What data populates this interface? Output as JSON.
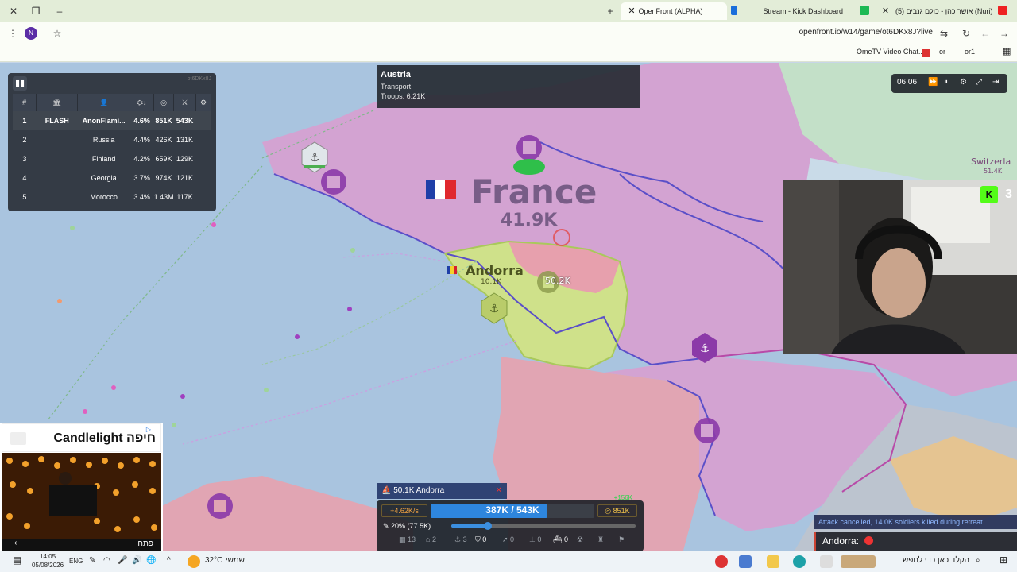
{
  "browser": {
    "tabs": [
      {
        "title": "OpenFront (ALPHA)",
        "active": true
      },
      {
        "title": "Stream - Kick Dashboard",
        "active": false
      },
      {
        "title": "(5) אושר כהן - כולם גנבים (Nuri)",
        "active": false
      }
    ],
    "url": "openfront.io/w14/game/ot6DKx8J?live",
    "profile_initial": "N",
    "bookmarks": [
      "OmeTV Video Chat...",
      "or",
      "or1"
    ]
  },
  "map": {
    "labels": [
      {
        "name": "France",
        "troops": "41.9K"
      },
      {
        "name": "Andorra",
        "troops": "10.1K"
      },
      {
        "name": "Switzerla",
        "troops": "51.4K"
      }
    ],
    "attack_label": "50.2K"
  },
  "leaderboard": {
    "game_id": "ot6DKx8J",
    "headers": {
      "rank": "#"
    },
    "rows": [
      {
        "rank": "1",
        "clan": "FLASH",
        "name": "AnonFlami...",
        "pct": "4.6%",
        "gold": "851K",
        "troops": "543K"
      },
      {
        "rank": "2",
        "clan": "",
        "name": "Russia",
        "pct": "4.4%",
        "gold": "426K",
        "troops": "131K"
      },
      {
        "rank": "3",
        "clan": "",
        "name": "Finland",
        "pct": "4.2%",
        "gold": "659K",
        "troops": "129K"
      },
      {
        "rank": "4",
        "clan": "",
        "name": "Georgia",
        "pct": "3.7%",
        "gold": "974K",
        "troops": "121K"
      },
      {
        "rank": "5",
        "clan": "",
        "name": "Morocco",
        "pct": "3.4%",
        "gold": "1.43M",
        "troops": "117K"
      }
    ]
  },
  "tooltip": {
    "name": "Austria",
    "type": "Transport",
    "troops": "Troops: 6.21K"
  },
  "time": {
    "clock": "06:06"
  },
  "webcam": {
    "kick_count": "3"
  },
  "ad": {
    "title": "Candlelight חיפה",
    "open_label": "פתח"
  },
  "panel": {
    "attack_target": "50.1K  Andorra",
    "rate": "+4.62K/s",
    "troops": "387K / 543K",
    "gold": "851K",
    "attack_ratio": "20% (77.5K)",
    "attack_ratio_value": 0.2,
    "gain": "+156K",
    "builds": [
      {
        "icon": "city-icon",
        "count": "13"
      },
      {
        "icon": "factory-icon",
        "count": "2"
      },
      {
        "icon": "port-icon",
        "count": "3"
      },
      {
        "icon": "defense-icon",
        "count": "0"
      },
      {
        "icon": "missile-icon",
        "count": "0"
      },
      {
        "icon": "sam-icon",
        "count": "0"
      },
      {
        "icon": "warship-icon",
        "count": "0"
      }
    ]
  },
  "notifications": {
    "cancel": "Attack cancelled, 14.0K soldiers killed during retreat",
    "andorra": "Andorra:"
  },
  "taskbar": {
    "time": "14:05",
    "date": "05/08/2026",
    "lang": "ENG",
    "temp": "32°C",
    "weather": "שמשי",
    "search": "הקלד כאן כדי לחפש"
  }
}
